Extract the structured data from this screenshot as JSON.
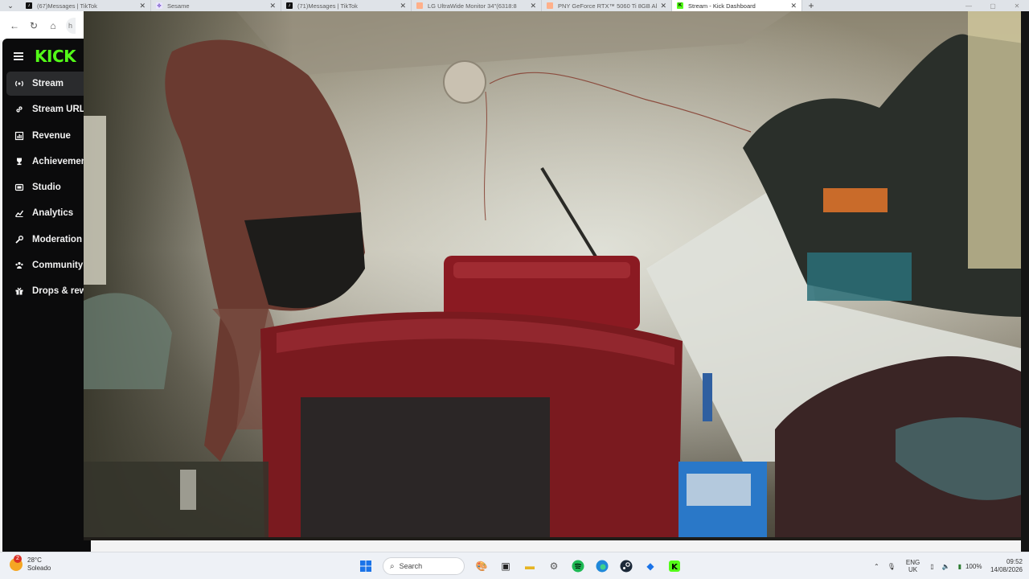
{
  "browser": {
    "tabs": [
      {
        "title": "(67)Messages | TikTok",
        "icon": "tiktok-icon",
        "fav_color": "#111111",
        "active": false
      },
      {
        "title": "Sesame",
        "icon": "sesame-icon",
        "fav_color": "#8a5cf6",
        "active": false
      },
      {
        "title": "(71)Messages | TikTok",
        "icon": "tiktok-icon",
        "fav_color": "#111111",
        "active": false
      },
      {
        "title": "LG UltraWide Monitor 34\"(6318:8",
        "icon": "amazon-icon",
        "fav_color": "#ff9f6b",
        "active": false
      },
      {
        "title": "PNY GeForce RTX™ 5060 Ti 8GB Al",
        "icon": "amazon-icon",
        "fav_color": "#ff9f6b",
        "active": false
      },
      {
        "title": "Stream - Kick Dashboard",
        "icon": "kick-icon",
        "fav_color": "#53fc18",
        "active": true
      }
    ],
    "address_prefix": "h"
  },
  "sidebar": {
    "logo": "KICK",
    "items": [
      {
        "label": "Stream",
        "icon": "broadcast-icon",
        "active": true
      },
      {
        "label": "Stream URL & Key",
        "icon": "link-icon",
        "active": false
      },
      {
        "label": "Revenue",
        "icon": "revenue-chart-icon",
        "active": false
      },
      {
        "label": "Achievements",
        "icon": "trophy-icon",
        "active": false
      },
      {
        "label": "Studio",
        "icon": "studio-icon",
        "active": false
      },
      {
        "label": "Analytics",
        "icon": "analytics-icon",
        "active": false
      },
      {
        "label": "Moderation",
        "icon": "wrench-icon",
        "active": false
      },
      {
        "label": "Community",
        "icon": "community-icon",
        "active": false
      },
      {
        "label": "Drops & rewards",
        "icon": "gift-icon",
        "active": false
      }
    ]
  },
  "video": {
    "content": "webcam-feed"
  },
  "taskbar": {
    "weather": {
      "temp": "28°C",
      "condition": "Soleado",
      "badge": "2"
    },
    "search_label": "Search",
    "language": {
      "lang": "ENG",
      "region": "UK"
    },
    "battery": "100%",
    "time": "09:52",
    "date": "14/08/2026"
  },
  "colors": {
    "kick_green": "#53fc18",
    "sidebar_bg": "#0b0b0c",
    "sidebar_active": "#2a2b2d"
  }
}
